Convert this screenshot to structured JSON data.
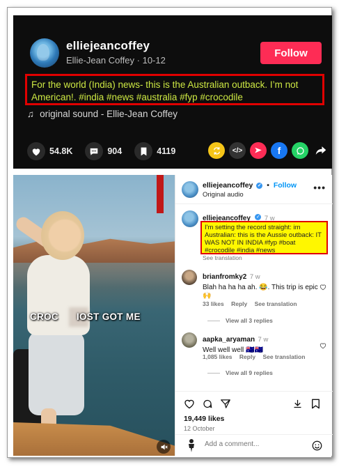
{
  "tiktok": {
    "username": "elliejeancoffey",
    "subline": "Ellie-Jean Coffey · 10-12",
    "follow_label": "Follow",
    "caption": "For the world (India) news- this is the Australian outback. I’m not American!. #india #news #australia #fyp #crocodile",
    "sound": "original sound - Ellie-Jean Coffey",
    "likes": "54.8K",
    "comments": "904",
    "saves": "4119",
    "share_icons": [
      "repost-icon",
      "embed-icon",
      "send-icon",
      "facebook-icon",
      "whatsapp-icon",
      "share-arrow-icon"
    ],
    "colors": {
      "follow": "#fe2c55",
      "caption_text": "#cde843",
      "highlight_border": "#e00000"
    }
  },
  "instagram": {
    "video": {
      "overlay_text_left": "CROC",
      "overlay_text_right": "IOST GOT ME"
    },
    "header": {
      "username": "elliejeancoffey",
      "follow_label": "Follow",
      "separator": "•",
      "audio": "Original audio",
      "more": "•••"
    },
    "post": {
      "username": "elliejeancoffey",
      "time": "7 w",
      "caption": "I'm setting the record straight: im Australian: this is the Aussie outback: IT WAS NOT IN INDIA #fyp #boat #crocodile #india #news",
      "see_translation": "See translation"
    },
    "comments": [
      {
        "username": "brianfromky2",
        "time": "7 w",
        "text": "Blah ha ha ha ah. 😂. This trip is epic 🙌",
        "likes": "33 likes",
        "reply": "Reply",
        "translation": "See translation",
        "view_replies": "View all 3 replies"
      },
      {
        "username": "aapka_aryaman",
        "time": "7 w",
        "text": "Well well well 🇦🇺🇦🇺",
        "likes": "1,085 likes",
        "reply": "Reply",
        "translation": "See translation",
        "view_replies": "View all 9 replies"
      }
    ],
    "likes_count": "19,449 likes",
    "date": "12 October",
    "add_comment_placeholder": "Add a comment...",
    "colors": {
      "link_blue": "#0095f6",
      "highlight_fill": "#fff700"
    }
  }
}
